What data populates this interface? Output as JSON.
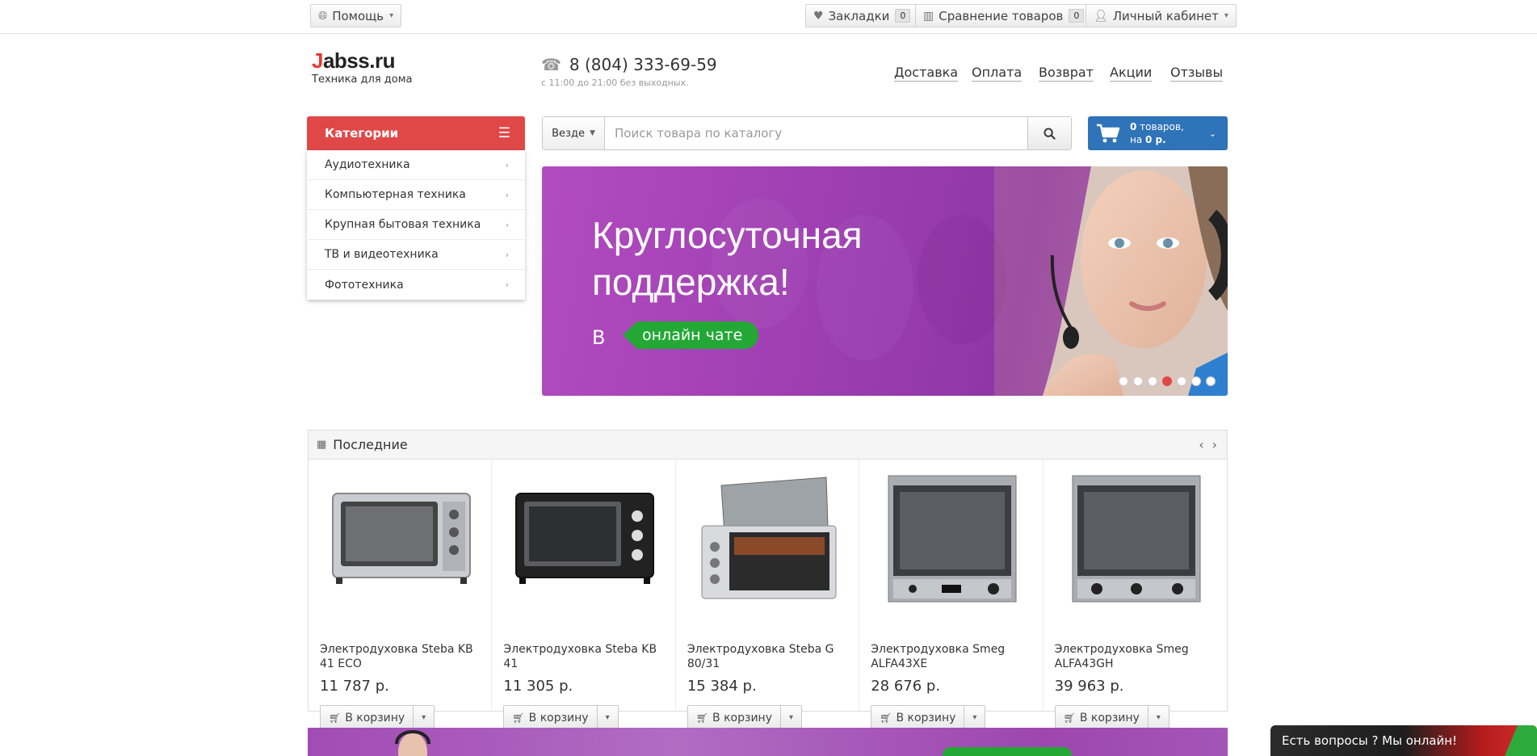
{
  "topbar": {
    "help_label": "Помощь",
    "bookmarks_label": "Закладки",
    "bookmarks_count": "0",
    "compare_label": "Сравнение товаров",
    "compare_count": "0",
    "account_label": "Личный кабинет"
  },
  "header": {
    "logo_first": "J",
    "logo_rest": "abss.ru",
    "logo_tagline": "Техника для дома",
    "phone": "8 (804) 333-69-59",
    "hours": "с 11:00 до 21:00 без выходных.",
    "nav": [
      "Доставка",
      "Оплата",
      "Возврат",
      "Акции",
      "Отзывы"
    ]
  },
  "categories": {
    "title": "Категории",
    "items": [
      "Аудиотехника",
      "Компьютерная техника",
      "Крупная бытовая техника",
      "ТВ и видеотехника",
      "Фототехника"
    ]
  },
  "search": {
    "scope": "Везде",
    "placeholder": "Поиск товара по каталогу"
  },
  "cart": {
    "count_bold": "0",
    "count_text": " товаров,",
    "sum_prefix": "на ",
    "sum_bold": "0 р."
  },
  "banner": {
    "title_line1": "Круглосуточная",
    "title_line2": "поддержка!",
    "prefix": "В",
    "pill": "онлайн чате",
    "slides_total": 7,
    "active_slide": 4
  },
  "latest": {
    "title": "Последние",
    "products": [
      {
        "name": "Электродуховка Steba KB 41 ECO",
        "price": "11 787 р.",
        "cart_label": "В корзину"
      },
      {
        "name": "Электродуховка Steba KB 41",
        "price": "11 305 р.",
        "cart_label": "В корзину"
      },
      {
        "name": "Электродуховка Steba G 80/31",
        "price": "15 384 р.",
        "cart_label": "В корзину"
      },
      {
        "name": "Электродуховка Smeg ALFA43XE",
        "price": "28 676 р.",
        "cart_label": "В корзину"
      },
      {
        "name": "Электродуховка Smeg ALFA43GH",
        "price": "39 963 р.",
        "cart_label": "В корзину"
      }
    ]
  },
  "chat": {
    "label": "Есть вопросы ? Мы онлайн!"
  },
  "colors": {
    "accent_red": "#e04848",
    "cart_blue": "#2f73b8",
    "banner_purple": "#9c3db0",
    "pill_green": "#23a836"
  }
}
